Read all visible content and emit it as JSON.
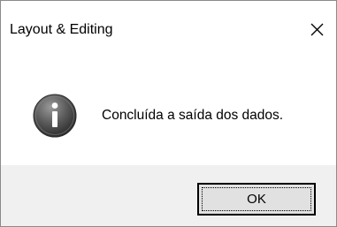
{
  "window": {
    "title": "Layout & Editing",
    "close_icon": "close-icon"
  },
  "content": {
    "icon": "info-icon",
    "message": "Concluída a saída dos dados."
  },
  "buttons": {
    "ok_label": "OK"
  }
}
